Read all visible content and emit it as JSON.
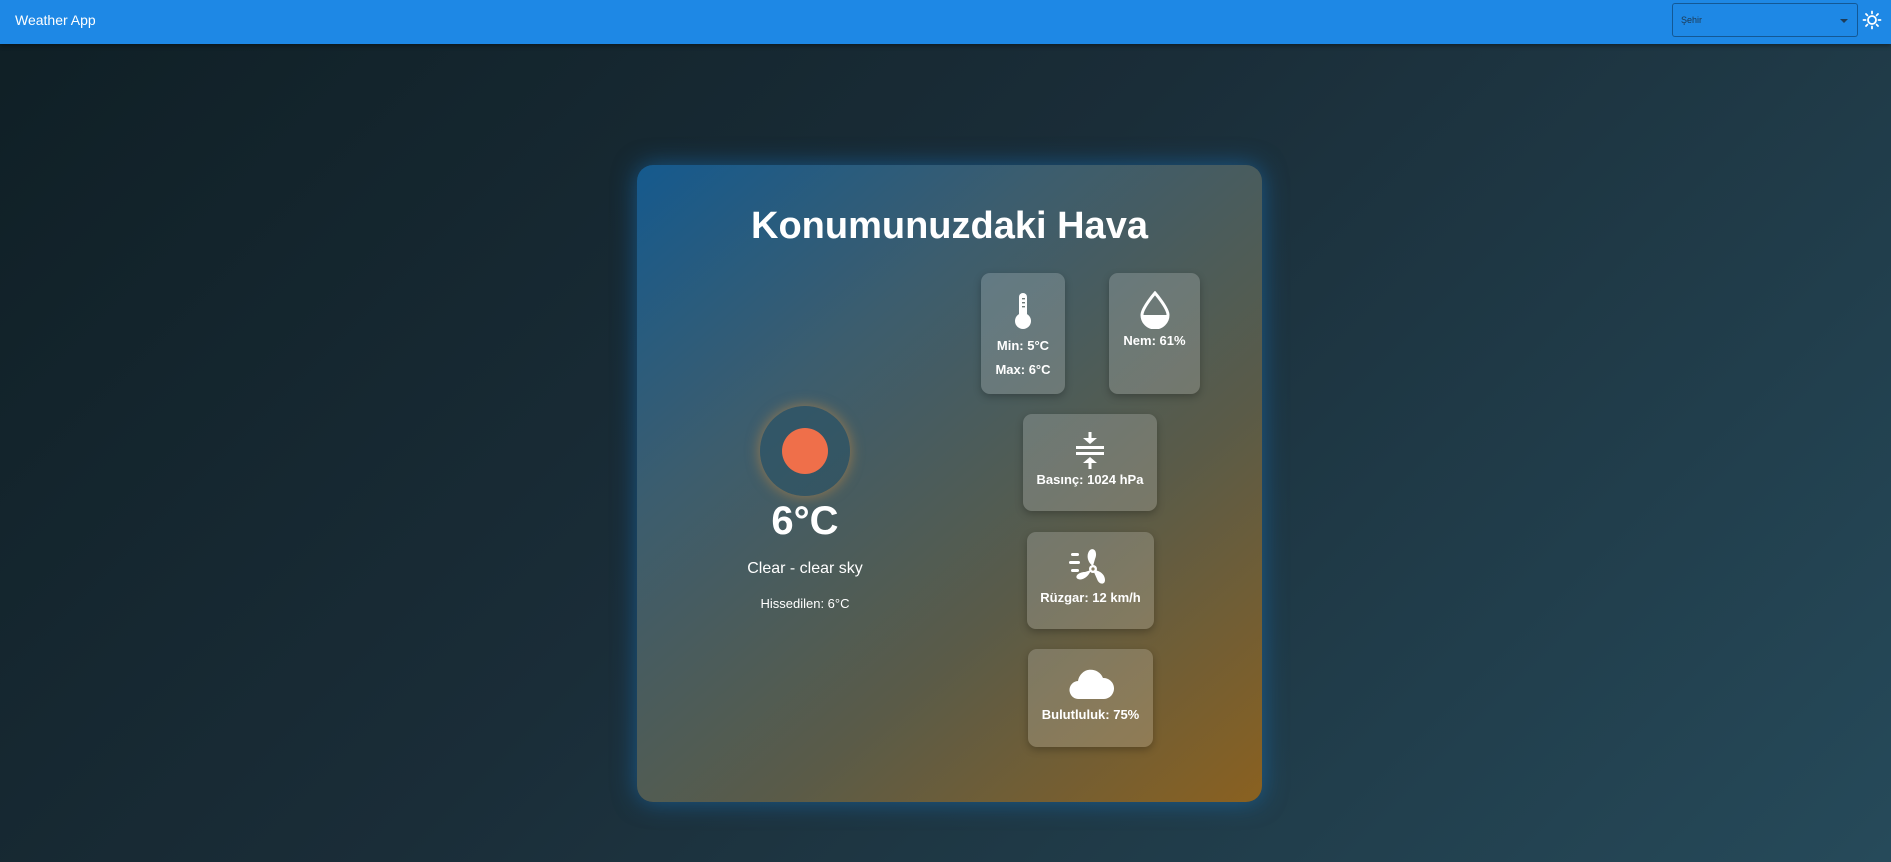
{
  "app": {
    "title": "Weather App"
  },
  "header": {
    "city_select": {
      "placeholder": "Şehir"
    },
    "theme_toggle_icon": "sun-icon"
  },
  "weather": {
    "title": "Konumunuzdaki Hava",
    "condition_icon": "clear-sky-sun-icon",
    "temperature": "6°C",
    "description": "Clear - clear sky",
    "feels_like": "Hissedilen: 6°C"
  },
  "details": {
    "temperature": {
      "icon": "thermometer-icon",
      "min": "Min: 5°C",
      "max": "Max: 6°C"
    },
    "humidity": {
      "icon": "droplet-icon",
      "label": "Nem: 61%"
    },
    "pressure": {
      "icon": "compress-arrows-icon",
      "label": "Basınç: 1024 hPa"
    },
    "wind": {
      "icon": "wind-fan-icon",
      "label": "Rüzgar: 12 km/h"
    },
    "cloudiness": {
      "icon": "cloud-icon",
      "label": "Bulutluluk: 75%"
    }
  },
  "colors": {
    "appbar": "#1e88e5",
    "sun": "#ef6f4a",
    "card_gradient_start": "#155a8e",
    "card_gradient_end": "#8a6120"
  }
}
